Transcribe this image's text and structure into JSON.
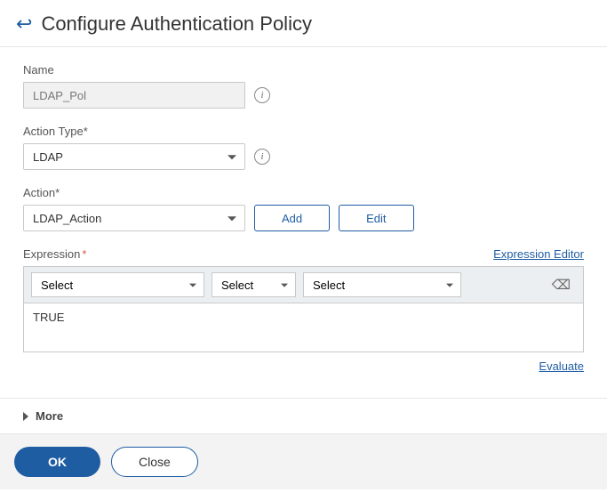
{
  "header": {
    "title": "Configure Authentication Policy"
  },
  "fields": {
    "name": {
      "label": "Name",
      "value": "LDAP_Pol"
    },
    "actionType": {
      "label": "Action Type*",
      "value": "LDAP"
    },
    "action": {
      "label": "Action*",
      "value": "LDAP_Action",
      "addLabel": "Add",
      "editLabel": "Edit"
    },
    "expression": {
      "label": "Expression",
      "editorLink": "Expression Editor",
      "sel1": "Select",
      "sel2": "Select",
      "sel3": "Select",
      "body": "TRUE",
      "evaluateLink": "Evaluate"
    }
  },
  "more": {
    "label": "More"
  },
  "footer": {
    "ok": "OK",
    "close": "Close"
  }
}
